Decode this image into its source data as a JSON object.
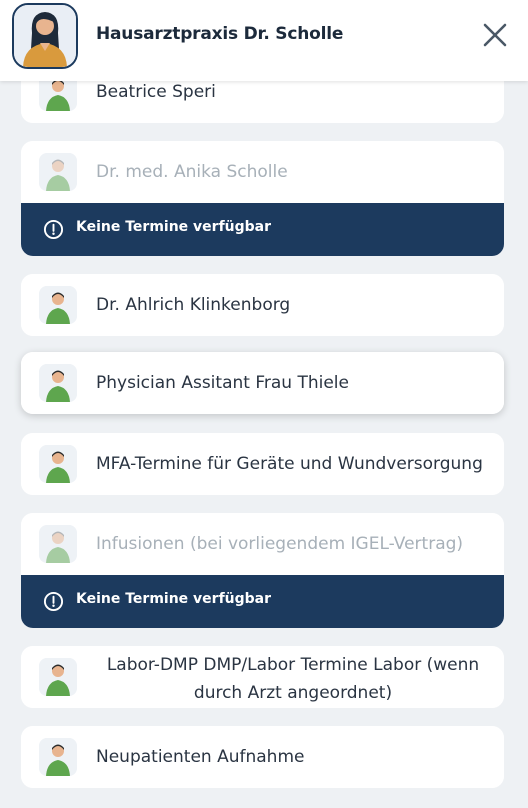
{
  "header": {
    "title": "Hausarztpraxis Dr. Scholle",
    "avatar_icon": "doctor-avatar-icon",
    "close_icon": "close-icon"
  },
  "colors": {
    "accent": "#1c3a5e",
    "background": "#eef1f4",
    "disabled_text": "#a7b0b8"
  },
  "unavailable_text": "Keine Termine verfügbar",
  "services": [
    {
      "label": "Beatrice Speri",
      "available": true
    },
    {
      "label": "Dr. med. Anika Scholle",
      "available": false,
      "banner": "Keine Termine verfügbar"
    },
    {
      "label": "Dr. Ahlrich Klinkenborg",
      "available": true
    },
    {
      "label": "Physician Assitant Frau Thiele",
      "available": true,
      "active": true
    },
    {
      "label": "MFA-Termine für Geräte und Wundversorgung",
      "available": true
    },
    {
      "label": "Infusionen (bei vorliegendem IGEL-Vertrag)",
      "available": false,
      "banner": "Keine Termine verfügbar"
    },
    {
      "label": "Labor-DMP DMP/Labor Termine Labor (wenn durch Arzt angeordnet)",
      "available": true
    },
    {
      "label": "Neupatienten Aufnahme",
      "available": true
    }
  ]
}
